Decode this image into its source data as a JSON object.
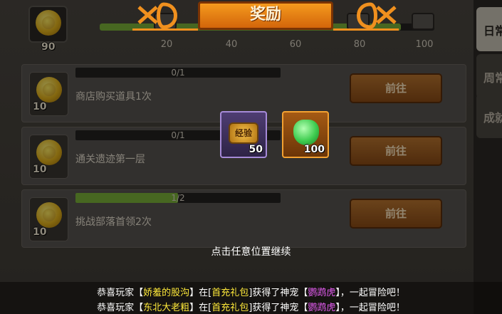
{
  "colors": {
    "accent": "#f0901e",
    "progress": "#7ab23a",
    "player_name": "#ffea3a",
    "pet_name": "#e35cf0"
  },
  "header": {
    "title": "奖励",
    "total_points": "90",
    "milestones": [
      "20",
      "40",
      "60",
      "80",
      "100"
    ]
  },
  "side_tabs": [
    "日常",
    "周常",
    "成就"
  ],
  "tasks": [
    {
      "progress_text": "0/1",
      "progress": 0.0,
      "title": "商店购买道具1次",
      "reward": "10",
      "button": "前往"
    },
    {
      "progress_text": "0/1",
      "progress": 0.0,
      "title": "通关遗迹第一层",
      "reward": "10",
      "button": "前往"
    },
    {
      "progress_text": "1/2",
      "progress": 0.5,
      "title": "挑战部落首领2次",
      "reward": "10",
      "button": "前往"
    }
  ],
  "rewards": [
    {
      "icon": "exp-icon",
      "badge_text": "经验",
      "count": "50",
      "rarity": "purple"
    },
    {
      "icon": "green-gem-icon",
      "count": "100",
      "rarity": "orange"
    }
  ],
  "continue_hint": "点击任意位置继续",
  "broadcast": [
    {
      "prefix": "恭喜玩家【",
      "player": "娇羞的股沟",
      "mid1": "】在[",
      "pack": "首充礼包",
      "mid2": "]获得了神宠【",
      "pet": "鹦鹉虎",
      "suffix": "】，一起冒险吧！"
    },
    {
      "prefix": "恭喜玩家【",
      "player": "东北大老粗",
      "mid1": "】在[",
      "pack": "首充礼包",
      "mid2": "]获得了神宠【",
      "pet": "鹦鹉虎",
      "suffix": "】，一起冒险吧！"
    }
  ]
}
